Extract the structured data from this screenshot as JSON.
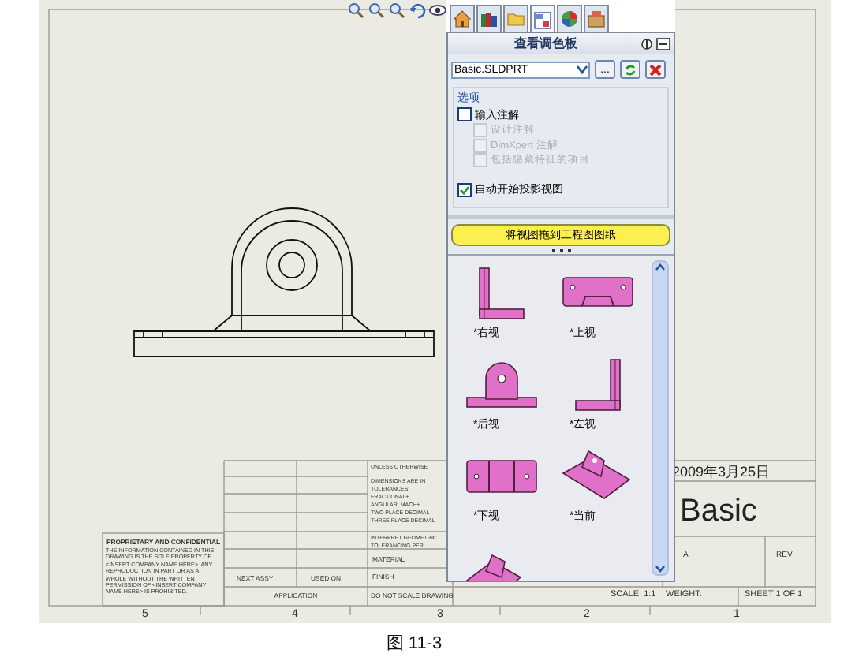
{
  "toolbar": {
    "icons": [
      {
        "kind": "zoom"
      },
      {
        "kind": "zoom"
      },
      {
        "kind": "zoom"
      },
      {
        "kind": "rotate"
      },
      {
        "kind": "eye"
      }
    ]
  },
  "sheet": {
    "zones": [
      "5",
      "4",
      "3",
      "2",
      "1"
    ],
    "confidential": {
      "title": "PROPRIETARY AND CONFIDENTIAL",
      "text": "THE INFORMATION CONTAINED IN THIS DRAWING IS THE SOLE PROPERTY OF <INSERT COMPANY NAME HERE>. ANY REPRODUCTION IN PART OR AS A WHOLE WITHOUT THE WRITTEN PERMISSION OF <INSERT COMPANY NAME HERE> IS PROHIBITED."
    },
    "next_assy": "NEXT ASSY",
    "used_on": "USED ON",
    "application": "APPLICATION",
    "do_not_scale": "DO NOT SCALE DRAWING",
    "tolerances": [
      "UNLESS OTHERWISE",
      "DIMENSIONS ARE IN",
      "TOLERANCES:",
      "FRACTIONAL±",
      "ANGULAR: MACH±",
      "TWO PLACE DECIMAL",
      "THREE PLACE DECIMAL"
    ],
    "geometric": [
      "INTERPRET GEOMETRIC",
      "TOLERANCING PER:"
    ],
    "material": "MATERIAL",
    "finish": "FINISH",
    "date": "2009年3月25日",
    "title": "Basic",
    "size": "A",
    "rev": "REV",
    "scale": "SCALE: 1:1",
    "weight": "WEIGHT:",
    "sheet_no": "SHEET 1 OF 1"
  },
  "palette": {
    "tabs": [
      {
        "kind": "home",
        "selected": false
      },
      {
        "kind": "library",
        "selected": false
      },
      {
        "kind": "folder",
        "selected": false
      },
      {
        "kind": "views",
        "selected": true
      },
      {
        "kind": "appearance",
        "selected": false
      },
      {
        "kind": "properties",
        "selected": false
      }
    ],
    "title": "查看调色板",
    "file": {
      "value": "Basic.SLDPRT"
    },
    "browse_button": "...",
    "options": {
      "title": "选项",
      "items": [
        {
          "label": "输入注解",
          "checked": false,
          "disabled": false,
          "children": [
            {
              "label": "设计注解",
              "checked": false,
              "disabled": true
            },
            {
              "label": "DimXpert 注解",
              "checked": false,
              "disabled": true
            },
            {
              "label": "包括隐藏特征的项目",
              "checked": false,
              "disabled": true
            }
          ]
        },
        {
          "label": "自动开始投影视图",
          "checked": true,
          "disabled": false
        }
      ]
    },
    "drag_hint": "将视图拖到工程图图纸",
    "views": [
      {
        "kind": "right",
        "label": "*右视"
      },
      {
        "kind": "top",
        "label": "*上视"
      },
      {
        "kind": "back",
        "label": "*后视"
      },
      {
        "kind": "left",
        "label": "*左视"
      },
      {
        "kind": "bottom",
        "label": "*下视"
      },
      {
        "kind": "iso",
        "label": "*当前"
      },
      {
        "kind": "iso2"
      }
    ]
  },
  "caption": "图 11-3"
}
